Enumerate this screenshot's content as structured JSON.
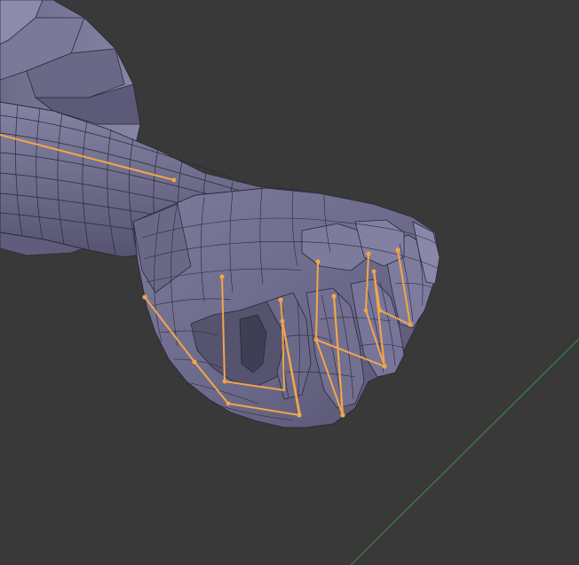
{
  "viewport": {
    "background_color": "#393939",
    "mesh_color": "#6d6b8a",
    "mesh_shadow_color": "#4f4d68",
    "mesh_highlight_color": "#8c8aa8",
    "wire_color": "#2a2938",
    "bone_color": "#f3a54a",
    "floor_axis_color": "#3f8f3f"
  },
  "scene": {
    "object": "rigged-fist-mesh",
    "mode": "wireframe-overlay"
  }
}
